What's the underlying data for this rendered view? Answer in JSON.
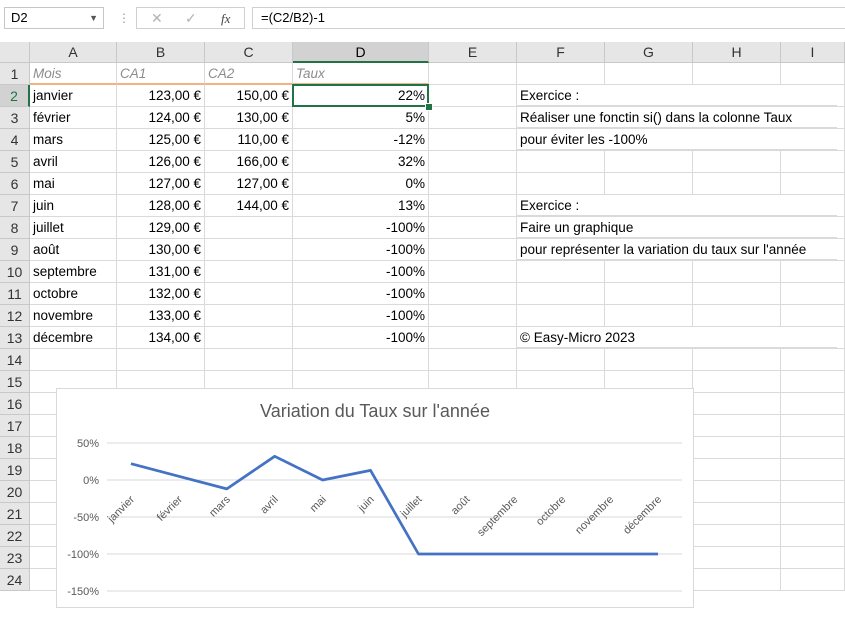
{
  "formula_bar": {
    "name_box": "D2",
    "cancel_icon": "✕",
    "enter_icon": "✓",
    "fx_label": "fx",
    "formula": "=(C2/B2)-1"
  },
  "columns": [
    "A",
    "B",
    "C",
    "D",
    "E",
    "F",
    "G",
    "H",
    "I"
  ],
  "rows": [
    "1",
    "2",
    "3",
    "4",
    "5",
    "6",
    "7",
    "8",
    "9",
    "10",
    "11",
    "12",
    "13",
    "14",
    "15",
    "16",
    "17",
    "18",
    "19",
    "20",
    "21",
    "22",
    "23",
    "24"
  ],
  "headers": {
    "mois": "Mois",
    "ca1": "CA1",
    "ca2": "CA2",
    "taux": "Taux"
  },
  "table": [
    {
      "mois": "janvier",
      "ca1": "123,00 €",
      "ca2": "150,00 €",
      "taux": "22%"
    },
    {
      "mois": "février",
      "ca1": "124,00 €",
      "ca2": "130,00 €",
      "taux": "5%"
    },
    {
      "mois": "mars",
      "ca1": "125,00 €",
      "ca2": "110,00 €",
      "taux": "-12%"
    },
    {
      "mois": "avril",
      "ca1": "126,00 €",
      "ca2": "166,00 €",
      "taux": "32%"
    },
    {
      "mois": "mai",
      "ca1": "127,00 €",
      "ca2": "127,00 €",
      "taux": "0%"
    },
    {
      "mois": "juin",
      "ca1": "128,00 €",
      "ca2": "144,00 €",
      "taux": "13%"
    },
    {
      "mois": "juillet",
      "ca1": "129,00 €",
      "ca2": "",
      "taux": "-100%"
    },
    {
      "mois": "août",
      "ca1": "130,00 €",
      "ca2": "",
      "taux": "-100%"
    },
    {
      "mois": "septembre",
      "ca1": "131,00 €",
      "ca2": "",
      "taux": "-100%"
    },
    {
      "mois": "octobre",
      "ca1": "132,00 €",
      "ca2": "",
      "taux": "-100%"
    },
    {
      "mois": "novembre",
      "ca1": "133,00 €",
      "ca2": "",
      "taux": "-100%"
    },
    {
      "mois": "décembre",
      "ca1": "134,00 €",
      "ca2": "",
      "taux": "-100%"
    }
  ],
  "notes": {
    "r2": "Exercice :",
    "r3": "Réaliser une fonctin si() dans la colonne Taux",
    "r4": "pour éviter les -100%",
    "r7": "Exercice :",
    "r8": "Faire un graphique",
    "r9": "pour représenter la variation du taux sur l'année",
    "r13": "© Easy-Micro 2023"
  },
  "colors": {
    "accent": "#217346",
    "series": "#4472c4",
    "header_underline": "#f4b183"
  },
  "chart_data": {
    "type": "line",
    "title": "Variation du Taux sur l'année",
    "categories": [
      "janvier",
      "février",
      "mars",
      "avril",
      "mai",
      "juin",
      "juillet",
      "août",
      "septembre",
      "octobre",
      "novembre",
      "décembre"
    ],
    "series": [
      {
        "values": [
          22,
          5,
          -12,
          32,
          0,
          13,
          -100,
          -100,
          -100,
          -100,
          -100,
          -100
        ]
      }
    ],
    "y_ticks": [
      "50%",
      "0%",
      "-50%",
      "-100%",
      "-150%"
    ],
    "y_tick_values": [
      50,
      0,
      -50,
      -100,
      -150
    ],
    "ylim": [
      -150,
      50
    ],
    "grid": true,
    "legend": "none"
  }
}
